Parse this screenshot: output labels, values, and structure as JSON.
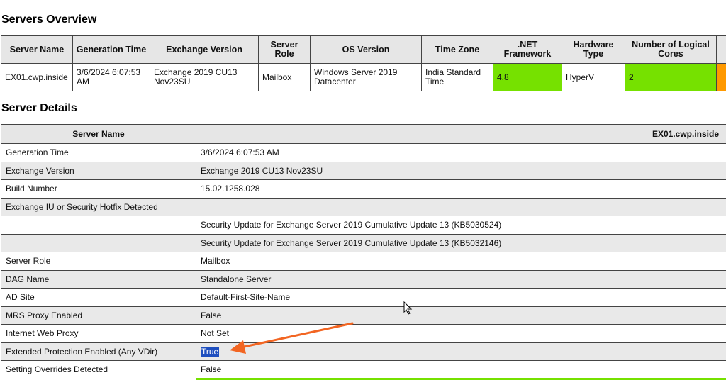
{
  "overview": {
    "title": "Servers Overview",
    "headers": [
      "Server Name",
      "Generation Time",
      "Exchange Version",
      "Server Role",
      "OS Version",
      "Time Zone",
      ".NET Framework",
      "Hardware Type",
      "Number of Logical Cores"
    ],
    "row": [
      "EX01.cwp.inside",
      "3/6/2024 6:07:53 AM",
      "Exchange 2019 CU13 Nov23SU",
      "Mailbox",
      "Windows Server 2019 Datacenter",
      "India Standard Time",
      "4.8",
      "HyperV",
      "2"
    ],
    "colors": {
      "ok": "#76e100",
      "warn": "#ff9900"
    }
  },
  "details": {
    "title": "Server Details",
    "header_label": "Server Name",
    "header_value": "EX01.cwp.inside",
    "rows": [
      {
        "label": "Generation Time",
        "value": "3/6/2024 6:07:53 AM"
      },
      {
        "label": "Exchange Version",
        "value": "Exchange 2019 CU13 Nov23SU"
      },
      {
        "label": "Build Number",
        "value": "15.02.1258.028"
      },
      {
        "label": "Exchange IU or Security Hotfix Detected",
        "value": ""
      },
      {
        "label": "",
        "value": "Security Update for Exchange Server 2019 Cumulative Update 13 (KB5030524)"
      },
      {
        "label": "",
        "value": "Security Update for Exchange Server 2019 Cumulative Update 13 (KB5032146)"
      },
      {
        "label": "Server Role",
        "value": "Mailbox"
      },
      {
        "label": "DAG Name",
        "value": "Standalone Server"
      },
      {
        "label": "AD Site",
        "value": "Default-First-Site-Name"
      },
      {
        "label": "MRS Proxy Enabled",
        "value": "False"
      },
      {
        "label": "Internet Web Proxy",
        "value": "Not Set"
      },
      {
        "label": "Extended Protection Enabled (Any VDir)",
        "value": "True"
      },
      {
        "label": "Setting Overrides Detected",
        "value": "False"
      }
    ],
    "highlight_color": "#1f4fbf"
  },
  "annotation": {
    "arrow_color": "#f26522"
  }
}
